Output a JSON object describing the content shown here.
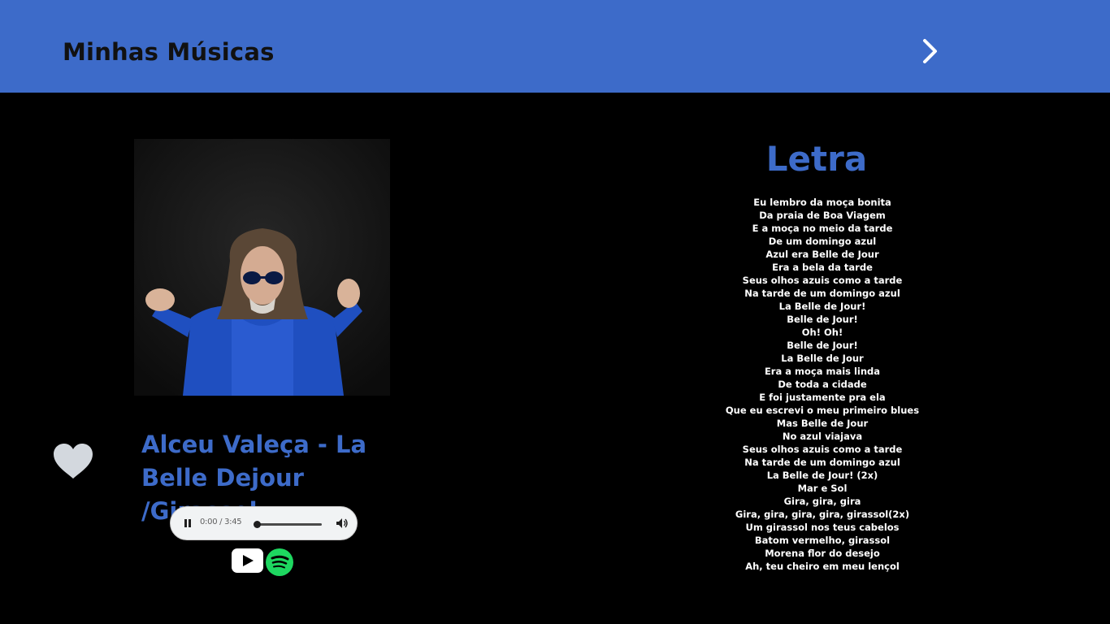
{
  "header": {
    "title": "Minhas Músicas",
    "next_icon": "chevron-right-icon"
  },
  "colors": {
    "accent": "#3d6bc9",
    "background": "#000000",
    "header_text": "#111111",
    "youtube_red": "#ff0000",
    "spotify_green": "#1ed760"
  },
  "song": {
    "title": "Alceu Valeça - La Belle Dejour  /Girassol",
    "favorite_icon": "heart-icon"
  },
  "player": {
    "time": "0:00 / 3:45",
    "progress": 0,
    "play_state_icon": "pause-icon",
    "volume_icon": "volume-icon"
  },
  "links": {
    "youtube_icon": "youtube-icon",
    "spotify_icon": "spotify-icon"
  },
  "lyrics": {
    "heading": "Letra",
    "lines": [
      "Eu lembro da moça bonita",
      "Da praia de Boa Viagem",
      "E a moça no meio da tarde",
      "De um domingo azul",
      "Azul era Belle de Jour",
      "Era a bela da tarde",
      "Seus olhos azuis como a tarde",
      "Na tarde de um domingo azul",
      "La Belle de Jour!",
      "Belle de Jour!",
      "Oh! Oh!",
      "Belle de Jour!",
      "La Belle de Jour",
      "Era a moça mais linda",
      "De toda a cidade",
      "E foi justamente pra ela",
      "Que eu escrevi o meu primeiro blues",
      "Mas Belle de Jour",
      "No azul viajava",
      "Seus olhos azuis como a tarde",
      "Na tarde de um domingo azul",
      "La Belle de Jour! (2x)",
      "Mar e Sol",
      "Gira, gira, gira",
      "Gira, gira, gira, gira, girassol(2x)",
      "Um girassol nos teus cabelos",
      "Batom vermelho, girassol",
      "Morena flor do desejo",
      "Ah, teu cheiro em meu lençol"
    ]
  }
}
